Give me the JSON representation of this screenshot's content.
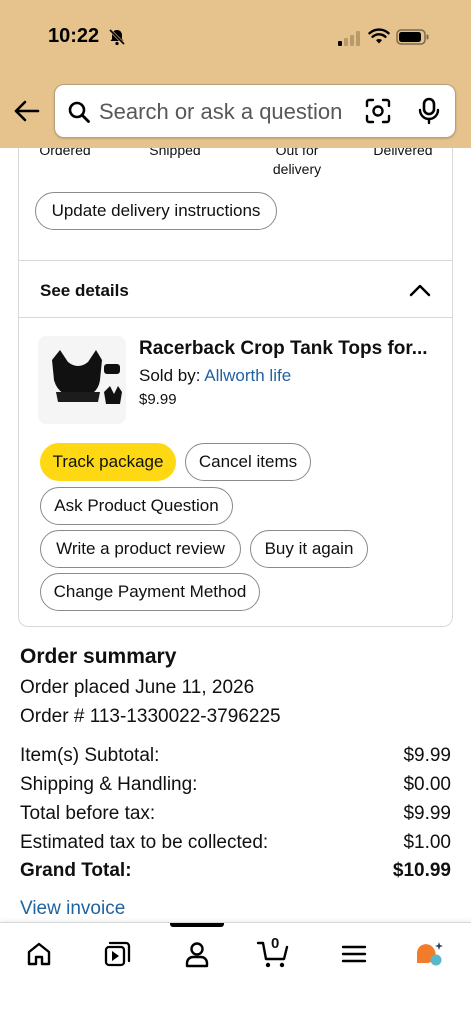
{
  "status_bar": {
    "time": "10:22"
  },
  "search": {
    "placeholder": "Search or ask a question"
  },
  "tracker": {
    "steps": [
      "Ordered",
      "Shipped",
      "Out for delivery",
      "Delivered"
    ]
  },
  "delivery": {
    "update_instructions_label": "Update delivery instructions"
  },
  "details": {
    "toggle_label": "See details"
  },
  "product": {
    "title": "Racerback Crop Tank Tops for...",
    "sold_by_prefix": "Sold by:",
    "seller": "Allworth life",
    "price": "$9.99"
  },
  "actions": {
    "track_package": "Track package",
    "cancel_items": "Cancel items",
    "ask_question": "Ask Product Question",
    "write_review": "Write a product review",
    "buy_again": "Buy it again",
    "change_payment": "Change Payment Method"
  },
  "summary": {
    "title": "Order summary",
    "order_placed": "Order placed June 11, 2026",
    "order_number": "Order # 113-1330022-3796225",
    "rows": [
      {
        "label": "Item(s) Subtotal:",
        "value": "$9.99"
      },
      {
        "label": "Shipping & Handling:",
        "value": "$0.00"
      },
      {
        "label": "Total before tax:",
        "value": "$9.99"
      },
      {
        "label": "Estimated tax to be collected:",
        "value": "$1.00"
      },
      {
        "label": "Grand Total:",
        "value": "$10.99"
      }
    ],
    "view_invoice": "View invoice"
  },
  "bottom_nav": {
    "items": [
      "home-icon",
      "video-icon",
      "account-icon",
      "cart-icon",
      "menu-icon",
      "assistant-icon"
    ],
    "cart_count": "0"
  },
  "colors": {
    "header_bg": "#e6c28c",
    "primary_button": "#ffd814",
    "link": "#2162a1",
    "assistant_orange": "#f27c2a",
    "assistant_teal": "#5ab6c8"
  }
}
